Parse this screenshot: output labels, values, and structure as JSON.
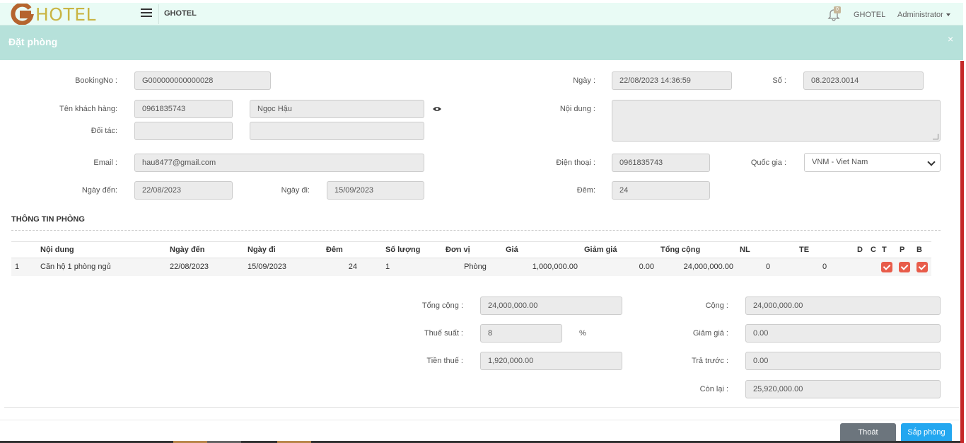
{
  "header": {
    "logo_text": "HOTEL",
    "brand": "GHOTEL",
    "notification_count": "0",
    "hotel_link": "GHOTEL",
    "user": "Administrator"
  },
  "modal": {
    "title": "Đặt phòng",
    "close": "×"
  },
  "form": {
    "booking_no_label": "BookingNo :",
    "booking_no": "G000000000000028",
    "date_label": "Ngày :",
    "date": "22/08/2023 14:36:59",
    "number_label": "Số :",
    "number": "08.2023.0014",
    "customer_label": "Tên khách hàng:",
    "customer_phone": "0961835743",
    "customer_name": "Ngọc Hậu",
    "content_label": "Nội dung :",
    "content": "",
    "partner_label": "Đối tác:",
    "partner_code": "",
    "partner_name": "",
    "email_label": "Email :",
    "email": "hau8477@gmail.com",
    "phone_label": "Điện thoại :",
    "phone": "0961835743",
    "country_label": "Quốc gia :",
    "country": "VNM - Viet Nam",
    "arrival_label": "Ngày đến:",
    "arrival": "22/08/2023",
    "departure_label": "Ngày đi:",
    "departure": "15/09/2023",
    "nights_label": "Đêm:",
    "nights": "24"
  },
  "rooms": {
    "section_title": "THÔNG TIN PHÒNG",
    "columns": [
      "Nội dung",
      "Ngày đến",
      "Ngày đi",
      "Đêm",
      "Số lượng",
      "Đơn vị",
      "Giá",
      "Giảm giá",
      "Tổng cộng",
      "NL",
      "TE",
      "D",
      "C",
      "T",
      "P",
      "B"
    ],
    "rows": [
      {
        "index": "1",
        "content": "Căn hộ 1 phòng ngủ",
        "arrival": "22/08/2023",
        "departure": "15/09/2023",
        "nights": "24",
        "quantity": "1",
        "unit": "Phòng",
        "price": "1,000,000.00",
        "discount": "0.00",
        "total": "24,000,000.00",
        "adults": "0",
        "children": "0"
      }
    ]
  },
  "summary": {
    "total_label": "Tổng cộng :",
    "total": "24,000,000.00",
    "tax_rate_label": "Thuế suất :",
    "tax_rate": "8",
    "percent": "%",
    "tax_label": "Tiền thuế :",
    "tax": "1,920,000.00",
    "sum_label": "Cộng :",
    "sum": "24,000,000.00",
    "discount_label": "Giảm giá :",
    "discount": "0.00",
    "prepaid_label": "Trả trước :",
    "prepaid": "0.00",
    "remaining_label": "Còn lại :",
    "remaining": "25,920,000.00"
  },
  "buttons": {
    "exit": "Thoát",
    "book": "Sắp phòng"
  }
}
